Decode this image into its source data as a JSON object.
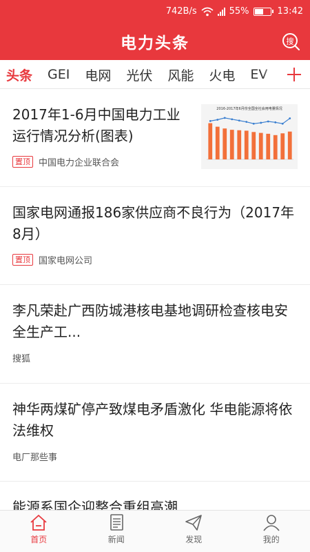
{
  "status_bar": {
    "speed": "742B/s",
    "battery": "55%",
    "battery_level": 0.55,
    "time": "13:42"
  },
  "app_bar": {
    "title": "电力头条",
    "search_icon_label": "搜",
    "color": "#e8383d"
  },
  "tabs": [
    "头条",
    "GEI",
    "电网",
    "光伏",
    "风能",
    "火电",
    "EV"
  ],
  "active_tab": "头条",
  "news": [
    {
      "title": "2017年1-6月中国电力工业运行情况分析(图表)",
      "pinned": true,
      "source": "中国电力企业联合会",
      "thumbnail": {
        "chart_title": "2016-2017年6月份全国全社会用电量情况",
        "chart_data": {
          "type": "bar",
          "bar_values": [
            8.2,
            7.4,
            7.0,
            6.7,
            6.6,
            6.5,
            6.2,
            6.0,
            5.8,
            5.5,
            5.9,
            6.3
          ],
          "line_values": [
            6.5,
            6.8,
            7.2,
            6.9,
            6.6,
            6.3,
            5.9,
            6.1,
            6.4,
            6.2,
            5.9,
            7.1
          ]
        }
      }
    },
    {
      "title": "国家电网通报186家供应商不良行为（2017年8月）",
      "pinned": true,
      "source": "国家电网公司"
    },
    {
      "title": "李凡荣赴广西防城港核电基地调研检查核电安全生产工...",
      "pinned": false,
      "source": "搜狐"
    },
    {
      "title": "神华两煤矿停产致煤电矛盾激化 华电能源将依法维权",
      "pinned": false,
      "source": "电厂那些事"
    },
    {
      "title": "能源系国企迎整合重组高潮",
      "pinned": false,
      "source": ""
    }
  ],
  "pin_label": "置顶",
  "bottom_nav": [
    {
      "label": "首页",
      "icon": "home-icon",
      "active": true
    },
    {
      "label": "新闻",
      "icon": "news-icon",
      "active": false
    },
    {
      "label": "发现",
      "icon": "discover-icon",
      "active": false
    },
    {
      "label": "我的",
      "icon": "profile-icon",
      "active": false
    }
  ]
}
